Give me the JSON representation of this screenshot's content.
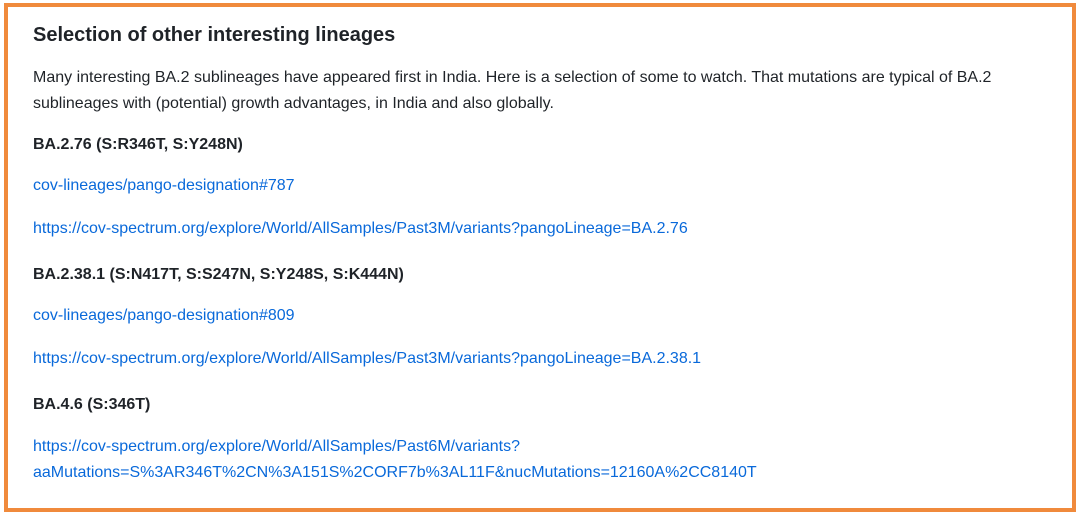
{
  "section": {
    "heading": "Selection of other interesting lineages",
    "intro": "Many interesting BA.2 sublineages have appeared first in India. Here is a selection of some to watch. That mutations are typical of BA.2 sublineages with (potential) growth advantages, in India and also globally."
  },
  "lineages": [
    {
      "title": "BA.2.76 (S:R346T, S:Y248N)",
      "links": [
        "cov-lineages/pango-designation#787",
        "https://cov-spectrum.org/explore/World/AllSamples/Past3M/variants?pangoLineage=BA.2.76"
      ]
    },
    {
      "title": "BA.2.38.1 (S:N417T, S:S247N, S:Y248S, S:K444N)",
      "links": [
        "cov-lineages/pango-designation#809",
        "https://cov-spectrum.org/explore/World/AllSamples/Past3M/variants?pangoLineage=BA.2.38.1"
      ]
    },
    {
      "title": "BA.4.6 (S:346T)",
      "links": [
        "https://cov-spectrum.org/explore/World/AllSamples/Past6M/variants?aaMutations=S%3AR346T%2CN%3A151S%2CORF7b%3AL11F&nucMutations=12160A%2CC8140T"
      ],
      "link_display_lines": [
        "https://cov-spectrum.org/explore/World/AllSamples/Past6M/variants?",
        "aaMutations=S%3AR346T%2CN%3A151S%2CORF7b%3AL11F&nucMutations=12160A%2CC8140T"
      ]
    }
  ],
  "colors": {
    "frame_border": "#f08a3c",
    "link": "#0969da",
    "text": "#1f2328"
  }
}
